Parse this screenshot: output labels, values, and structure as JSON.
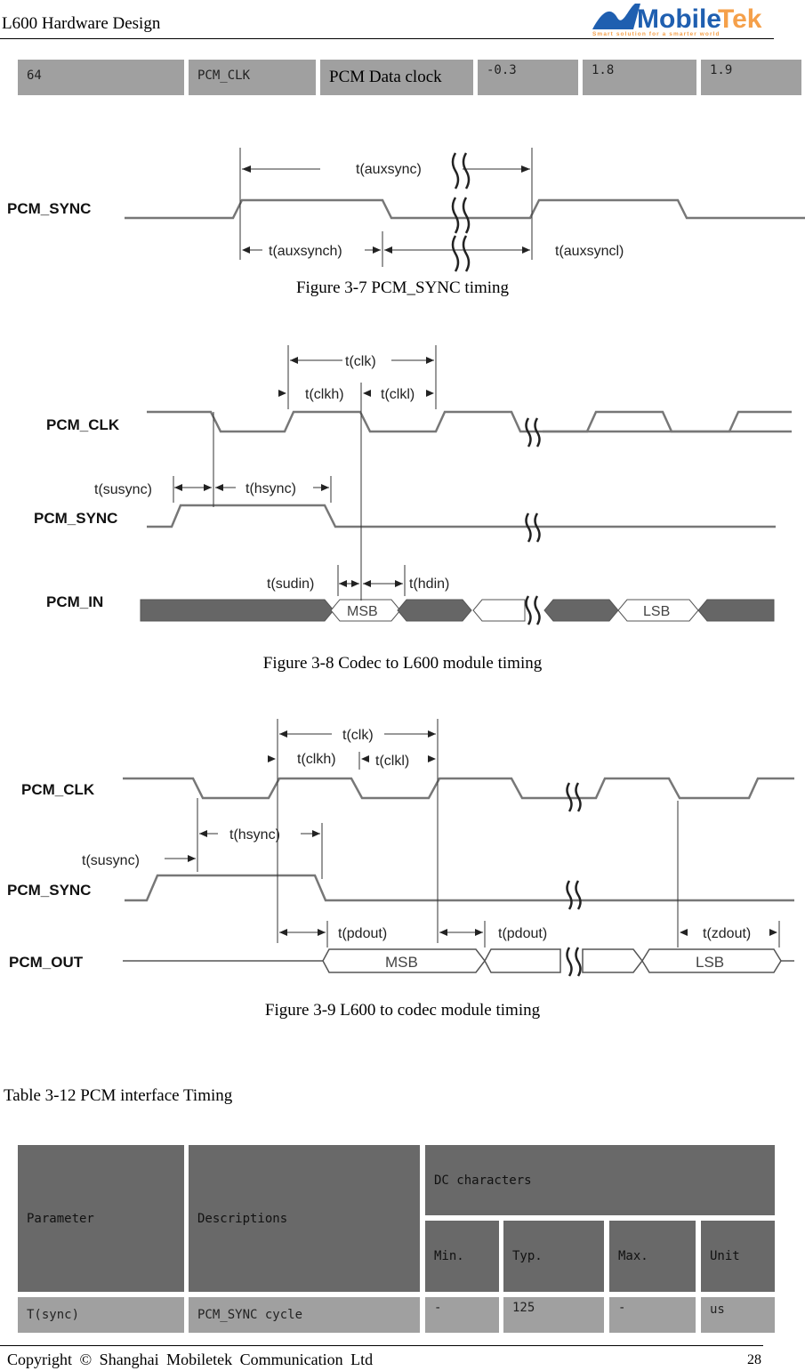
{
  "header": {
    "title": "L600 Hardware Design",
    "logo": {
      "brand_left": "Mobile",
      "brand_right": "Tek",
      "tagline": "Smart solution for a smarter world",
      "colors": {
        "blue": "#1f5fb0",
        "orange": "#f5a04a"
      }
    }
  },
  "top_row": {
    "cells": [
      "64",
      "PCM_CLK",
      "PCM Data clock",
      "-0.3",
      "1.8",
      "1.9"
    ]
  },
  "figures": [
    {
      "caption": "Figure 3-7 PCM_SYNC timing",
      "signals": [
        "PCM_SYNC"
      ],
      "annotations": [
        "t(auxsync)",
        "t(auxsynch)",
        "t(auxsyncl)"
      ]
    },
    {
      "caption": "Figure 3-8 Codec to L600 module timing",
      "signals": [
        "PCM_CLK",
        "PCM_SYNC",
        "PCM_IN"
      ],
      "annotations": [
        "t(clk)",
        "t(clkh)",
        "t(clkl)",
        "t(susync)",
        "t(hsync)",
        "t(sudin)",
        "t(hdin)"
      ],
      "data_labels": [
        "MSB",
        "LSB"
      ]
    },
    {
      "caption": "Figure 3-9 L600 to codec module timing",
      "signals": [
        "PCM_CLK",
        "PCM_SYNC",
        "PCM_OUT"
      ],
      "annotations": [
        "t(clk)",
        "t(clkh)",
        "t(clkl)",
        "t(hsync)",
        "t(susync)",
        "t(pdout)",
        "t(pdout)",
        "t(zdout)"
      ],
      "data_labels": [
        "MSB",
        "LSB"
      ]
    }
  ],
  "table": {
    "caption": "Table 3-12 PCM interface Timing",
    "headers": {
      "parameter": "Parameter",
      "descriptions": "Descriptions",
      "group": "DC characters",
      "min": "Min.",
      "typ": "Typ.",
      "max": "Max.",
      "unit": "Unit"
    },
    "rows": [
      {
        "parameter": "T(sync)",
        "description": "PCM_SYNC cycle",
        "min": "-",
        "typ": "125",
        "max": "-",
        "unit": "us"
      }
    ]
  },
  "footer": {
    "copyright": "Copyright © Shanghai Mobiletek Communication Ltd",
    "page": "28"
  }
}
